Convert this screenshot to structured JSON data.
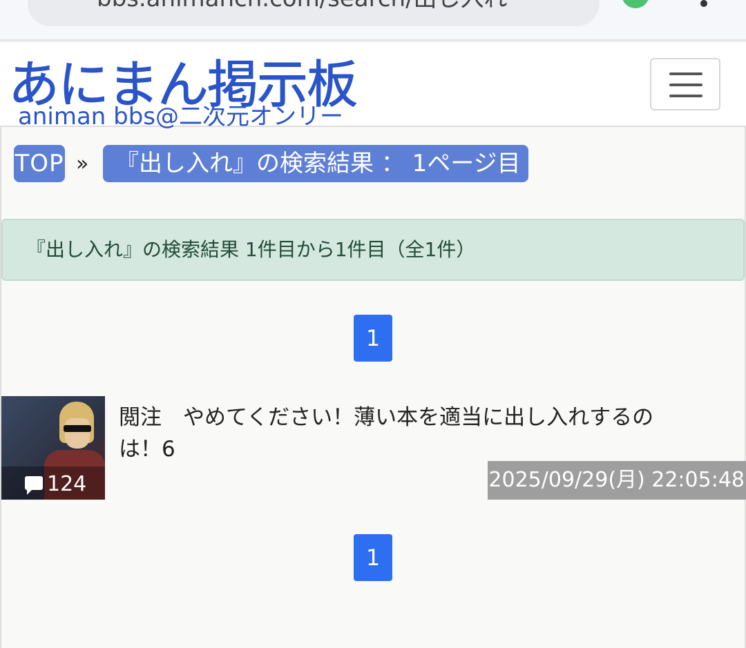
{
  "browser": {
    "url": "bbs.animanch.com/search/出し入れ"
  },
  "header": {
    "logo_main": "あにまん掲示板",
    "logo_sub": "animan bbs@二次元オンリー",
    "menu_button": "menu"
  },
  "breadcrumb": {
    "top": "TOP",
    "separator": "»",
    "current": "『出し入れ』の検索結果 ： 1ページ目"
  },
  "search_summary": "『出し入れ』の検索結果 1件目から1件目（全1件）",
  "pagination": {
    "pages": [
      "1"
    ]
  },
  "threads": [
    {
      "title": "閲注　やめてください！薄い本を適当に出し入れするのは！6",
      "comment_count": "124",
      "date": "2025/09/29(月) 22:05:48"
    }
  ],
  "colors": {
    "brand": "#2a55c8",
    "breadcrumb_bg": "#5e7fd6",
    "alert_bg": "#d4e8df",
    "pager_bg": "#2e6ef0",
    "date_bg": "#9e9e9e"
  }
}
